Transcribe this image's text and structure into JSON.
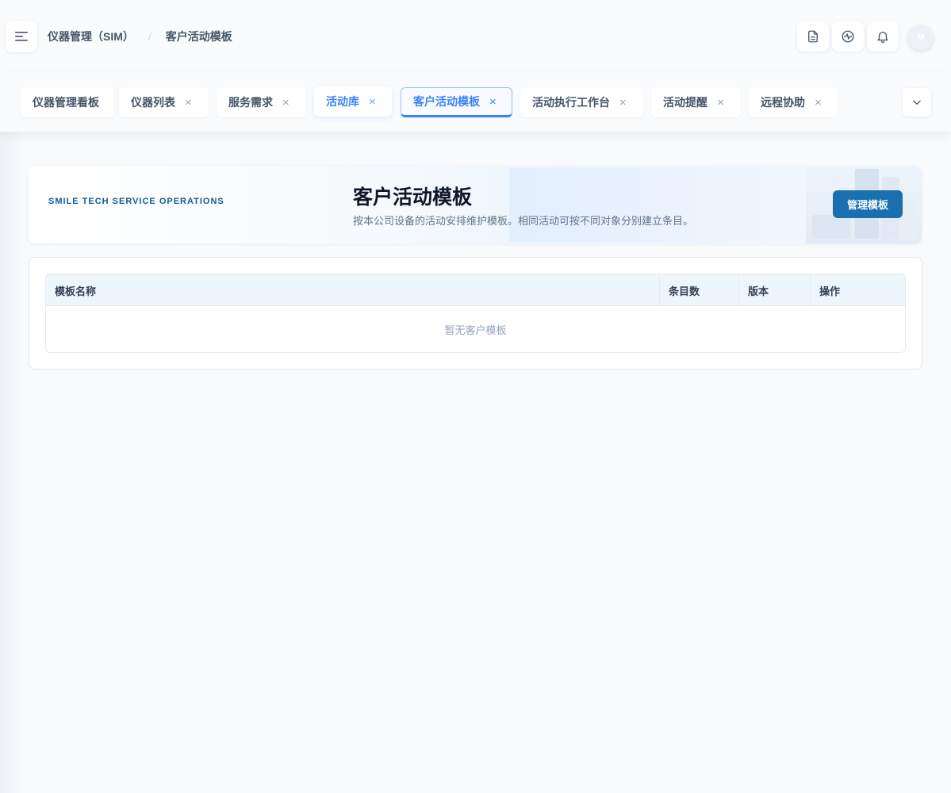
{
  "header": {
    "breadcrumb": [
      "仪器管理（SIM）",
      "客户活动模板"
    ],
    "breadcrumb_separator": "/",
    "avatar_initial": "M",
    "actions": [
      "document-icon",
      "activity-icon",
      "bell-icon"
    ]
  },
  "tabs": [
    {
      "label": "仪器管理看板",
      "closable": false
    },
    {
      "label": "仪器列表",
      "closable": true
    },
    {
      "label": "服务需求",
      "closable": true
    },
    {
      "label": "活动库",
      "closable": true
    },
    {
      "label": "客户活动模板",
      "closable": true,
      "active": true
    },
    {
      "label": "活动执行工作台",
      "closable": true
    },
    {
      "label": "活动提醒",
      "closable": true
    },
    {
      "label": "远程协助",
      "closable": true
    }
  ],
  "close_glyph": "×",
  "banner": {
    "brand": "SMILE TECH SERVICE OPERATIONS",
    "title": "客户活动模板",
    "description": "按本公司设备的活动安排维护模板。相同活动可按不同对象分别建立条目。",
    "button_label": "管理模板"
  },
  "table": {
    "columns": [
      "模板名称",
      "条目数",
      "版本",
      "操作"
    ],
    "empty_text": "暂无客户模板"
  },
  "colors": {
    "accent": "#3b82f6",
    "brand": "#0f5d99",
    "primary_button": "#1a6fb0"
  }
}
